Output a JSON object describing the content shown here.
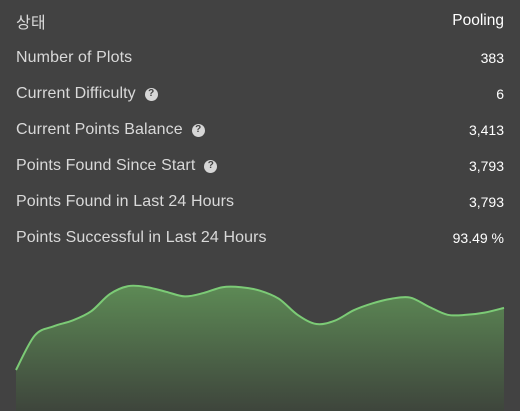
{
  "status": {
    "label": "상태",
    "value": "Pooling"
  },
  "stats": [
    {
      "label": "Number of Plots",
      "value": "383",
      "help": false
    },
    {
      "label": "Current Difficulty",
      "value": "6",
      "help": true
    },
    {
      "label": "Current Points Balance",
      "value": "3,413",
      "help": true
    },
    {
      "label": "Points Found Since Start",
      "value": "3,793",
      "help": true
    },
    {
      "label": "Points Found in Last 24 Hours",
      "value": "3,793",
      "help": false
    },
    {
      "label": "Points Successful in Last 24 Hours",
      "value": "93.49 %",
      "help": false
    }
  ],
  "help_icon": {
    "glyph": "?",
    "name": "help-icon"
  },
  "colors": {
    "background": "#424242",
    "line": "#7ccb76",
    "fill_top": "#5d8a55",
    "fill_bottom": "#3e453c"
  },
  "chart_data": {
    "type": "area",
    "title": "",
    "xlabel": "",
    "ylabel": "",
    "ylim": [
      0,
      100
    ],
    "grid": false,
    "legend": "none",
    "series": [
      {
        "values": [
          0,
          30,
          38,
          43,
          51,
          66,
          73,
          72,
          68,
          64,
          67,
          72,
          72,
          69,
          62,
          48,
          40,
          43,
          52,
          58,
          62,
          63,
          55,
          48,
          48,
          50,
          54
        ]
      }
    ]
  }
}
